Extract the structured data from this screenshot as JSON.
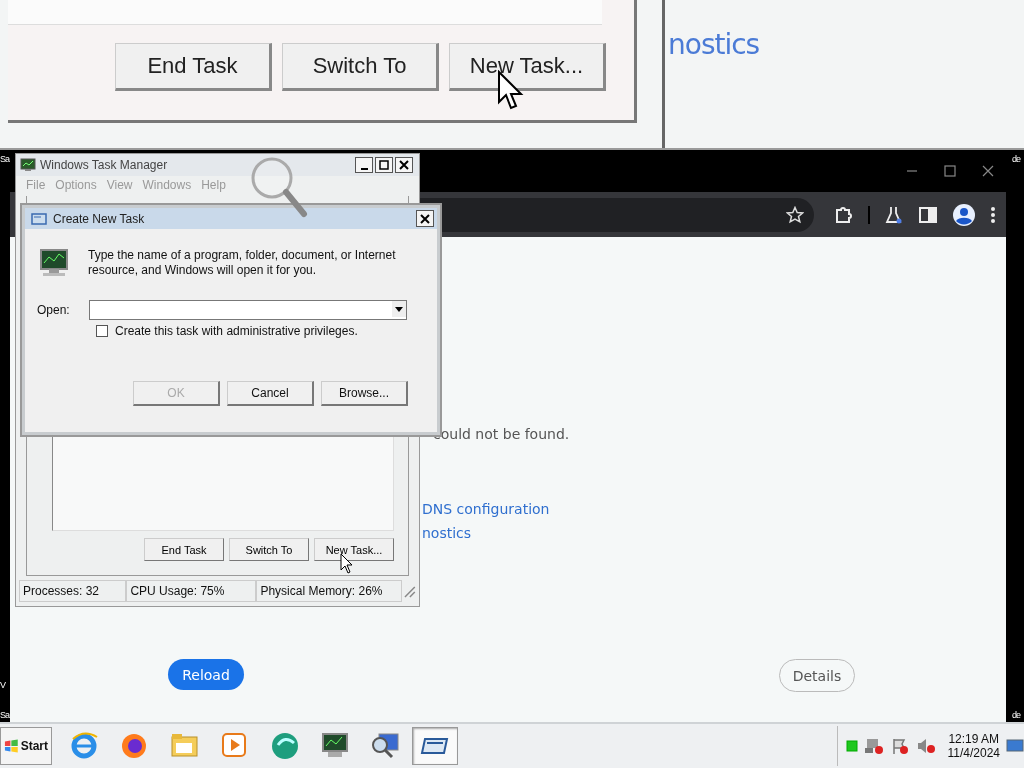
{
  "zoom_inset": {
    "buttons": [
      {
        "label": "End Task"
      },
      {
        "label": "Switch To"
      },
      {
        "label": "New Task..."
      }
    ],
    "link_fragment": "nostics"
  },
  "desktop_edge_texts": [
    "Sa",
    "de",
    "V",
    "Sa",
    "de"
  ],
  "browser": {
    "error_text": "could not be found.",
    "links": [
      "DNS configuration",
      "nostics"
    ],
    "buttons": [
      {
        "label": "Reload",
        "kind": "primary"
      },
      {
        "label": "Details",
        "kind": "secondary"
      }
    ]
  },
  "task_manager": {
    "title": "Windows Task Manager",
    "menu": [
      "File",
      "Options",
      "View",
      "Windows",
      "Help"
    ],
    "buttons": [
      {
        "label": "End Task"
      },
      {
        "label": "Switch To"
      },
      {
        "label": "New Task..."
      }
    ],
    "status": [
      "Processes: 32",
      "CPU Usage: 75%",
      "Physical Memory: 26%"
    ]
  },
  "dialog": {
    "title": "Create New Task",
    "message": "Type the name of a program, folder, document, or Internet resource, and Windows will open it for you.",
    "open_label": "Open:",
    "checkbox": {
      "label": "Create this task with administrative privileges.",
      "checked": false
    },
    "buttons": [
      {
        "label": "OK",
        "disabled": true
      },
      {
        "label": "Cancel",
        "disabled": false
      },
      {
        "label": "Browse...",
        "disabled": false
      }
    ]
  },
  "taskbar": {
    "start": "Start",
    "apps": [
      {
        "kind": "ie",
        "selected": false
      },
      {
        "kind": "firefox",
        "selected": false
      },
      {
        "kind": "folder",
        "selected": false
      },
      {
        "kind": "media",
        "selected": false
      },
      {
        "kind": "orb",
        "selected": false
      },
      {
        "kind": "monitor",
        "selected": false
      },
      {
        "kind": "magnifier",
        "selected": false
      },
      {
        "kind": "window",
        "selected": true
      }
    ],
    "clock": {
      "time": "12:19 AM",
      "date": "11/4/2024"
    }
  }
}
